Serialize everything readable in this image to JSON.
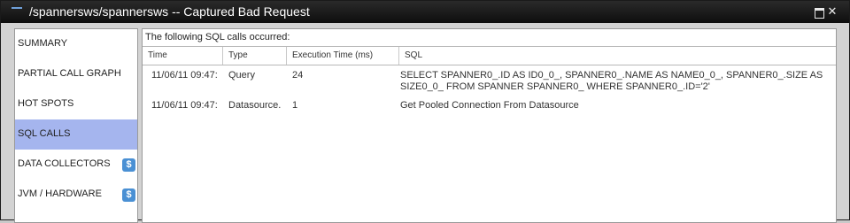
{
  "window": {
    "title": "/spannersws/spannersws -- Captured Bad Request",
    "icons": {
      "app": "menu-icon",
      "maximize": "maximize-icon",
      "close": "close-icon"
    },
    "close_glyph": "✕"
  },
  "sidebar": {
    "items": [
      {
        "label": "SUMMARY",
        "active": false
      },
      {
        "label": "PARTIAL CALL GRAPH",
        "active": false
      },
      {
        "label": "HOT SPOTS",
        "active": false
      },
      {
        "label": "SQL CALLS",
        "active": true
      },
      {
        "label": "DATA COLLECTORS",
        "active": false,
        "icon": "dollar-icon",
        "icon_glyph": "$"
      },
      {
        "label": "JVM / HARDWARE",
        "active": false,
        "icon": "dollar-icon",
        "icon_glyph": "$"
      }
    ],
    "active_color": "#a5b5ee"
  },
  "main": {
    "heading": "The following SQL calls occurred:",
    "columns": [
      "Time",
      "Type",
      "Execution Time (ms)",
      "SQL"
    ],
    "rows": [
      {
        "time": "11/06/11 09:47:",
        "type": "Query",
        "exec_ms": "24",
        "sql": "SELECT SPANNER0_.ID AS ID0_0_, SPANNER0_.NAME AS NAME0_0_, SPANNER0_.SIZE AS SIZE0_0_ FROM SPANNER SPANNER0_ WHERE SPANNER0_.ID='2'"
      },
      {
        "time": "11/06/11 09:47:",
        "type": "Datasource.",
        "exec_ms": "1",
        "sql": "Get Pooled Connection From Datasource"
      }
    ]
  }
}
